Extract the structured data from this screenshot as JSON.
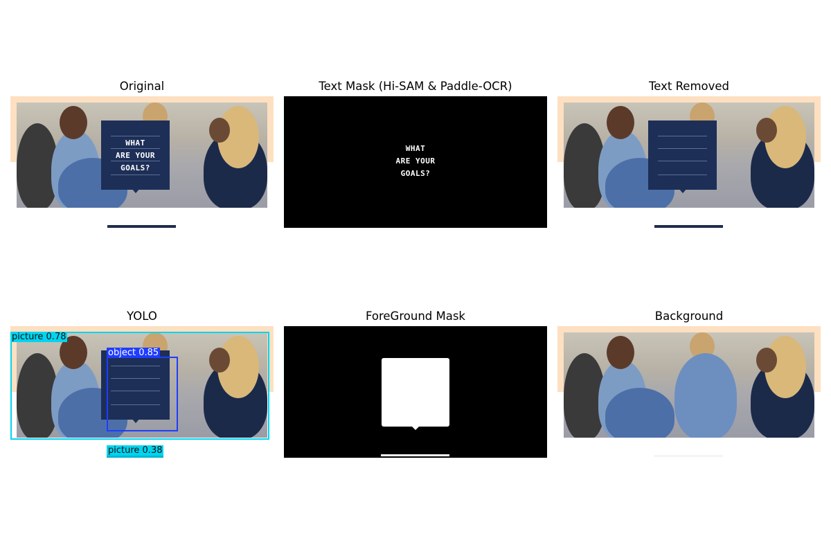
{
  "panels": [
    {
      "title": "Original"
    },
    {
      "title": "Text Mask (Hi-SAM & Paddle-OCR)"
    },
    {
      "title": "Text Removed"
    },
    {
      "title": "YOLO"
    },
    {
      "title": "ForeGround Mask"
    },
    {
      "title": "Background"
    }
  ],
  "card_text": [
    "WHAT",
    "ARE YOUR",
    "GOALS?"
  ],
  "yolo_detections": [
    {
      "label": "picture 0.78",
      "color": "#00d4f0"
    },
    {
      "label": "object 0.85",
      "color": "#1f3cff"
    },
    {
      "label": "picture 0.38",
      "color": "#00d4f0"
    }
  ],
  "colors": {
    "peach": "#fde0c1",
    "navy": "#1d2f57",
    "cyan": "#00d4f0",
    "blue": "#1f3cff"
  }
}
